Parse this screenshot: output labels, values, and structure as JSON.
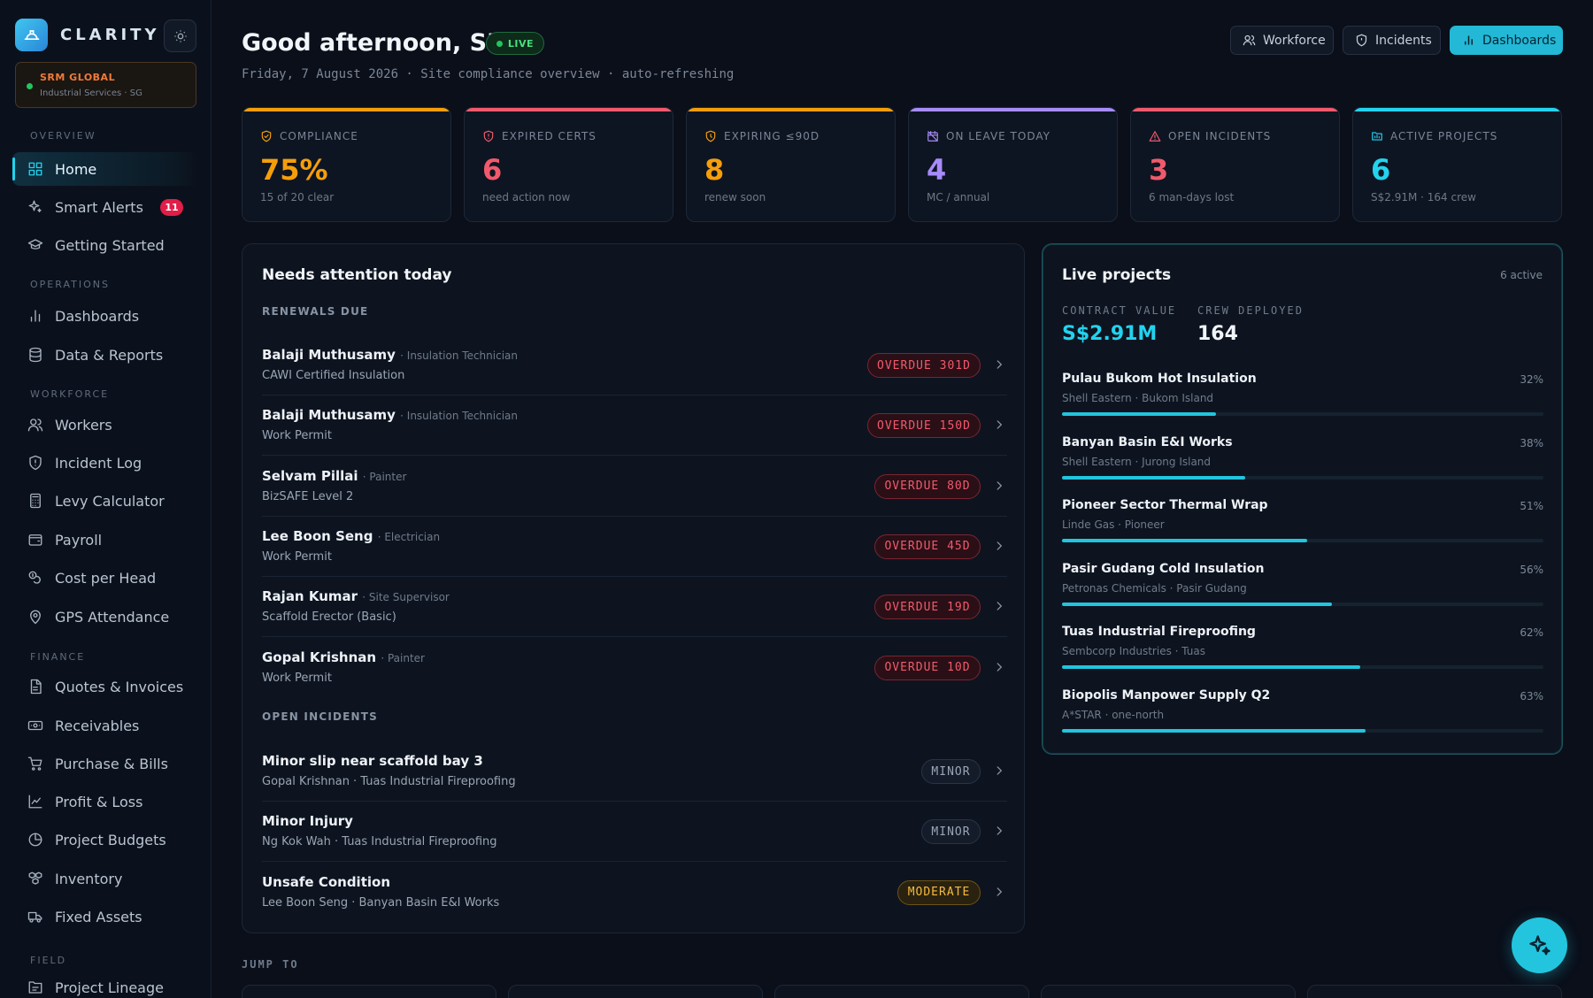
{
  "brand": {
    "name": "CLARITY"
  },
  "org": {
    "name": "SRM GLOBAL",
    "sub": "Industrial Services · SG"
  },
  "sidebar": {
    "sections": [
      {
        "title": "OVERVIEW"
      },
      {
        "title": "OPERATIONS"
      },
      {
        "title": "WORKFORCE"
      },
      {
        "title": "FINANCE"
      },
      {
        "title": "FIELD"
      }
    ],
    "items": [
      {
        "label": "Home",
        "icon": "grid-icon"
      },
      {
        "label": "Smart Alerts",
        "icon": "sparkle-icon",
        "badge": "11"
      },
      {
        "label": "Getting Started",
        "icon": "graduation-cap-icon"
      },
      {
        "label": "Dashboards",
        "icon": "bar-chart-icon"
      },
      {
        "label": "Data & Reports",
        "icon": "database-icon"
      },
      {
        "label": "Workers",
        "icon": "users-icon"
      },
      {
        "label": "Incident Log",
        "icon": "shield-icon"
      },
      {
        "label": "Levy Calculator",
        "icon": "calculator-icon"
      },
      {
        "label": "Payroll",
        "icon": "wallet-icon"
      },
      {
        "label": "Cost per Head",
        "icon": "coins-icon"
      },
      {
        "label": "GPS Attendance",
        "icon": "map-pin-icon"
      },
      {
        "label": "Quotes & Invoices",
        "icon": "file-text-icon"
      },
      {
        "label": "Receivables",
        "icon": "banknote-icon"
      },
      {
        "label": "Purchase & Bills",
        "icon": "cart-icon"
      },
      {
        "label": "Profit & Loss",
        "icon": "line-chart-icon"
      },
      {
        "label": "Project Budgets",
        "icon": "pie-chart-icon"
      },
      {
        "label": "Inventory",
        "icon": "boxes-icon"
      },
      {
        "label": "Fixed Assets",
        "icon": "truck-icon"
      },
      {
        "label": "Project Lineage",
        "icon": "folder-tree-icon"
      }
    ]
  },
  "header": {
    "greeting": "Good afternoon, SRM",
    "live": "LIVE",
    "subline": "Friday, 7 August 2026 · Site compliance overview · auto-refreshing",
    "buttons": [
      {
        "label": "Workforce",
        "icon": "users-icon"
      },
      {
        "label": "Incidents",
        "icon": "shield-icon"
      },
      {
        "label": "Dashboards",
        "icon": "bar-chart-icon"
      }
    ]
  },
  "stats": [
    {
      "label": "COMPLIANCE",
      "value": "75%",
      "sub": "15 of 20 clear",
      "color": "#f59e0b",
      "icon": "shield-check-icon"
    },
    {
      "label": "EXPIRED CERTS",
      "value": "6",
      "sub": "need action now",
      "color": "#f05a6c",
      "icon": "shield-alert-icon"
    },
    {
      "label": "EXPIRING ≤90D",
      "value": "8",
      "sub": "renew soon",
      "color": "#f59e0b",
      "icon": "shield-clock-icon"
    },
    {
      "label": "ON LEAVE TODAY",
      "value": "4",
      "sub": "MC / annual",
      "color": "#a78bfa",
      "icon": "calendar-off-icon"
    },
    {
      "label": "OPEN INCIDENTS",
      "value": "3",
      "sub": "6 man-days lost",
      "color": "#f05a6c",
      "icon": "warning-icon"
    },
    {
      "label": "ACTIVE PROJECTS",
      "value": "6",
      "sub": "S$2.91M · 164 crew",
      "color": "#22d3ee",
      "icon": "folder-icon"
    }
  ],
  "attention": {
    "title": "Needs attention today",
    "renewals_title": "RENEWALS DUE",
    "renewals": [
      {
        "name": "Balaji Muthusamy",
        "role": "· Insulation Technician",
        "doc": "CAWI Certified Insulation",
        "status": "OVERDUE 301D"
      },
      {
        "name": "Balaji Muthusamy",
        "role": "· Insulation Technician",
        "doc": "Work Permit",
        "status": "OVERDUE 150D"
      },
      {
        "name": "Selvam Pillai",
        "role": "· Painter",
        "doc": "BizSAFE Level 2",
        "status": "OVERDUE 80D"
      },
      {
        "name": "Lee Boon Seng",
        "role": "· Electrician",
        "doc": "Work Permit",
        "status": "OVERDUE 45D"
      },
      {
        "name": "Rajan Kumar",
        "role": "· Site Supervisor",
        "doc": "Scaffold Erector (Basic)",
        "status": "OVERDUE 19D"
      },
      {
        "name": "Gopal Krishnan",
        "role": "· Painter",
        "doc": "Work Permit",
        "status": "OVERDUE 10D"
      }
    ],
    "incidents_title": "OPEN INCIDENTS",
    "incidents": [
      {
        "title": "Minor slip near scaffold bay 3",
        "detail": "Gopal Krishnan · Tuas Industrial Fireproofing",
        "severity": "MINOR"
      },
      {
        "title": "Minor Injury",
        "detail": "Ng Kok Wah · Tuas Industrial Fireproofing",
        "severity": "MINOR"
      },
      {
        "title": "Unsafe Condition",
        "detail": "Lee Boon Seng · Banyan Basin E&I Works",
        "severity": "MODERATE"
      }
    ]
  },
  "projects": {
    "title": "Live projects",
    "count": "6 active",
    "contract_label": "CONTRACT VALUE",
    "contract_value": "S$2.91M",
    "crew_label": "CREW DEPLOYED",
    "crew_value": "164",
    "items": [
      {
        "name": "Pulau Bukom Hot Insulation",
        "client": "Shell Eastern · Bukom Island",
        "pct_label": "32%",
        "progress": 0.32
      },
      {
        "name": "Banyan Basin E&I Works",
        "client": "Shell Eastern · Jurong Island",
        "pct_label": "38%",
        "progress": 0.38
      },
      {
        "name": "Pioneer Sector Thermal Wrap",
        "client": "Linde Gas · Pioneer",
        "pct_label": "51%",
        "progress": 0.51
      },
      {
        "name": "Pasir Gudang Cold Insulation",
        "client": "Petronas Chemicals · Pasir Gudang",
        "pct_label": "56%",
        "progress": 0.56
      },
      {
        "name": "Tuas Industrial Fireproofing",
        "client": "Sembcorp Industries · Tuas",
        "pct_label": "62%",
        "progress": 0.62
      },
      {
        "name": "Biopolis Manpower Supply Q2",
        "client": "A*STAR · one-north",
        "pct_label": "63%",
        "progress": 0.63
      }
    ]
  },
  "jump": {
    "title": "JUMP TO"
  },
  "colors": {
    "accent": "#22d3ee",
    "danger": "#f05a6c",
    "warning": "#f59e0b",
    "success": "#22c55e"
  }
}
